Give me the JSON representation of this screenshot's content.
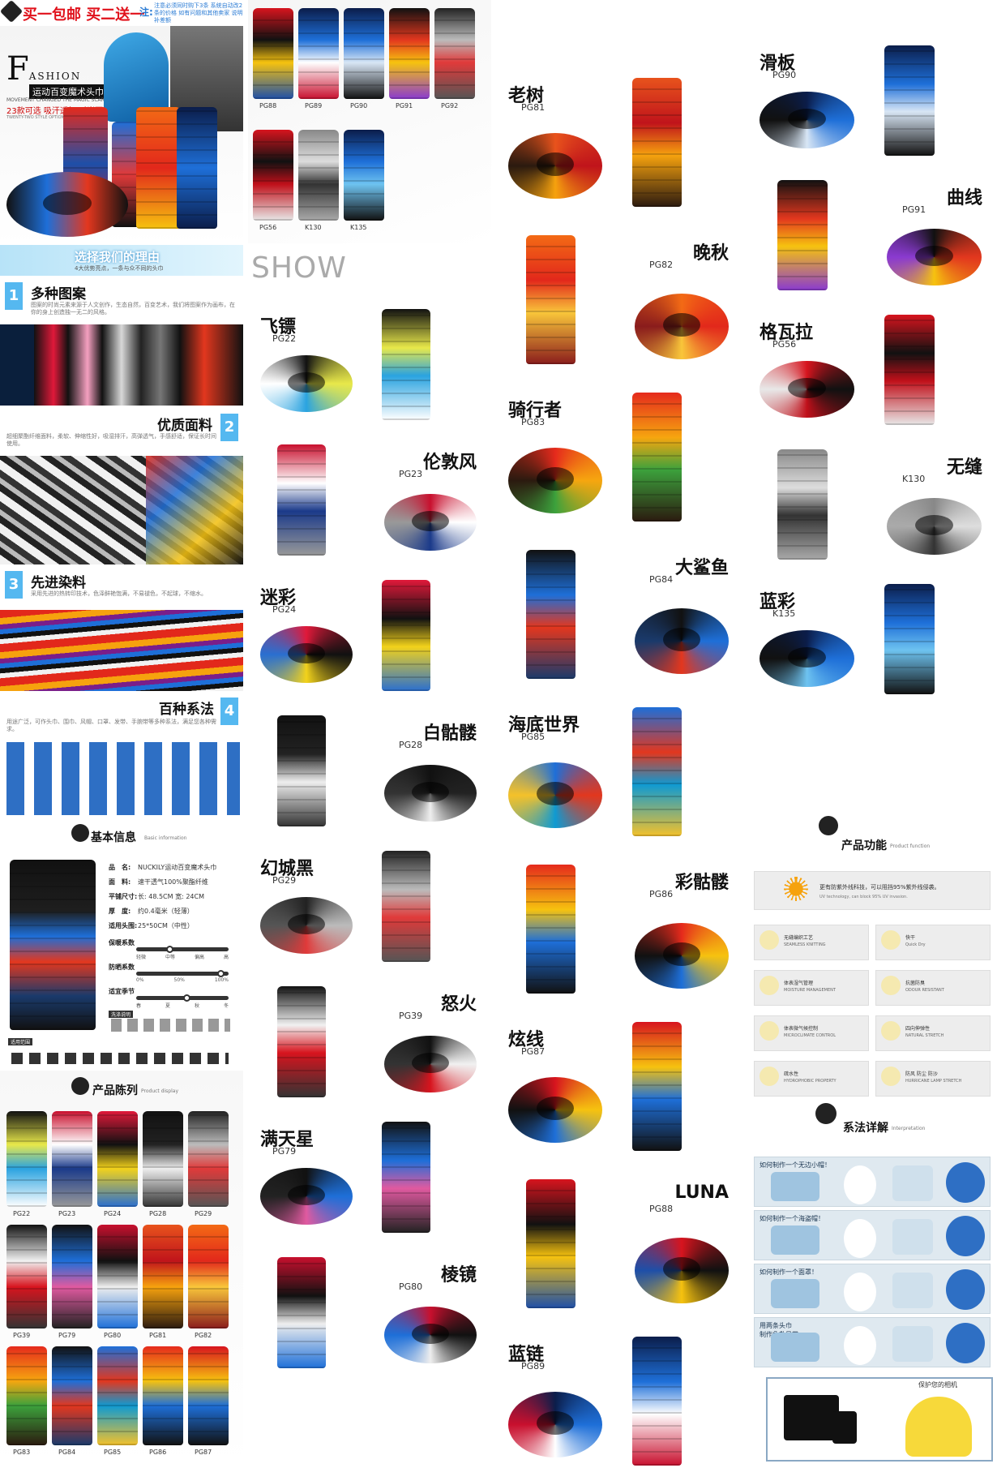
{
  "header": {
    "promo": "买一包邮 买二送一",
    "promo_colon": "注:",
    "promo_note": "注意必须同时购下3条 系统自动改2条的价格 如有问题和其他卖家 说明补差额"
  },
  "hero": {
    "fashion_initial": "F",
    "fashion_rest": "ASHION",
    "subtitle": "运动百变魔术头巾",
    "tagline_en": "MOVEMENT CHANGED THE MAGIC SCARF",
    "styles_line": "23款可选 吸汗透气 时尚百搭",
    "styles_en": "TWENTY-TWO STYLE OPTIONAL"
  },
  "reasons": {
    "title": "选择我们的理由",
    "sub": "4大优势亮点，一条与众不同的头巾"
  },
  "features": [
    {
      "num": "1",
      "title": "多种图案",
      "desc": "图案的时尚元素来源于人文创作，生态自然，百变艺术，我们将图案作为画布，在你的身上创造独一无二的风格。"
    },
    {
      "num": "2",
      "title": "优质面料",
      "desc": "超细聚酯纤维面料，柔软、伸缩性好，吸湿排汗，高弹透气，手感舒适，保证长时间使用。"
    },
    {
      "num": "3",
      "title": "先进染料",
      "desc": "采用先进的热转印技术，色泽鲜艳饱满，不易褪色，不起球，不缩水。"
    },
    {
      "num": "4",
      "title": "百种系法",
      "desc": "用途广泛，可作头巾、围巾、风帽、口罩、发带、手腕带等多种系法，满足您各种需求。"
    }
  ],
  "basic_info": {
    "title": "基本信息",
    "title_en": "Basic information",
    "rows": [
      {
        "k": "品　名:",
        "v": "NUCKILY运动百变魔术头巾"
      },
      {
        "k": "面　料:",
        "v": "速干透气100%聚酯纤维"
      },
      {
        "k": "平铺尺寸:",
        "v": "长: 48.5CM 宽: 24CM"
      },
      {
        "k": "厚　度:",
        "v": "约0.4毫米（轻薄）"
      },
      {
        "k": "适用头围:",
        "v": "25*50CM（中性）"
      }
    ],
    "scales": [
      {
        "label": "保暖系数",
        "marks": [
          "轻微",
          "中等",
          "偏高",
          "高"
        ],
        "level": 0.35
      },
      {
        "label": "防晒系数",
        "marks": [
          "0%",
          "50%",
          "100%"
        ],
        "level": 0.95
      },
      {
        "label": "适宜季节",
        "marks": [
          "春",
          "夏",
          "秋",
          "冬"
        ],
        "level": 0.55
      }
    ],
    "washing_label": "洗涤说明",
    "usage_label": "适用范围"
  },
  "display": {
    "title": "产品陈列",
    "title_en": "Product display",
    "row1": [
      "PG22",
      "PG23",
      "PG24",
      "PG28",
      "PG29"
    ],
    "row2": [
      "PG39",
      "PG79",
      "PG80",
      "PG81",
      "PG82"
    ],
    "row3": [
      "PG83",
      "PG84",
      "PG85",
      "PG86",
      "PG87"
    ]
  },
  "top_grid": {
    "row1": [
      "PG88",
      "PG89",
      "PG90",
      "PG91",
      "PG92"
    ],
    "row2": [
      "PG56",
      "K130",
      "K135"
    ]
  },
  "show_label": "SHOW",
  "products_col2": [
    {
      "name": "飞镖",
      "code": "PG22",
      "colors": [
        "#111",
        "#e8e84a",
        "#2aa3e0",
        "#ffffff"
      ]
    },
    {
      "name": "伦敦风",
      "code": "PG23",
      "colors": [
        "#c8102e",
        "#ffffff",
        "#1b3a8a",
        "#999"
      ]
    },
    {
      "name": "迷彩",
      "code": "PG24",
      "colors": [
        "#e0193a",
        "#111",
        "#f2d21b",
        "#2a6fd0"
      ]
    },
    {
      "name": "白骷髅",
      "code": "PG28",
      "colors": [
        "#111",
        "#222",
        "#eee",
        "#333"
      ]
    },
    {
      "name": "幻城黑",
      "code": "PG29",
      "colors": [
        "#222",
        "#bbb",
        "#e03a3a",
        "#555"
      ]
    },
    {
      "name": "怒火",
      "code": "PG39",
      "colors": [
        "#111",
        "#f1f1f1",
        "#d7141e",
        "#333"
      ]
    },
    {
      "name": "满天星",
      "code": "PG79",
      "colors": [
        "#111",
        "#1e6fd8",
        "#e05aa0",
        "#222"
      ]
    },
    {
      "name": "棱镜",
      "code": "PG80",
      "colors": [
        "#c8102e",
        "#111",
        "#eee",
        "#1e6fd8"
      ]
    }
  ],
  "products_col3": [
    {
      "name": "老树",
      "code": "PG81",
      "colors": [
        "#e8531c",
        "#c0141b",
        "#f6a20e",
        "#2b1a0f"
      ]
    },
    {
      "name": "晚秋",
      "code": "PG82",
      "colors": [
        "#f36a15",
        "#e2281b",
        "#f9c63a",
        "#8a1c1c"
      ]
    },
    {
      "name": "骑行者",
      "code": "PG83",
      "colors": [
        "#e52a1c",
        "#f6a60f",
        "#3ca13c",
        "#2b1a0f"
      ]
    },
    {
      "name": "大鲨鱼",
      "code": "PG84",
      "colors": [
        "#111",
        "#1e6fd8",
        "#e3371e",
        "#1a3a6b"
      ]
    },
    {
      "name": "海底世界",
      "code": "PG85",
      "colors": [
        "#1e6fd8",
        "#e2371e",
        "#0f9ad2",
        "#f4c12a"
      ]
    },
    {
      "name": "彩骷髅",
      "code": "PG86",
      "colors": [
        "#e52a1c",
        "#f6c20f",
        "#1e6fd8",
        "#111"
      ]
    },
    {
      "name": "炫线",
      "code": "PG87",
      "colors": [
        "#d7141e",
        "#f6c20f",
        "#1e6fd8",
        "#111"
      ]
    },
    {
      "name": "LUNA",
      "code": "PG88",
      "colors": [
        "#d7141e",
        "#111",
        "#f6c20f",
        "#1e4fa8"
      ]
    },
    {
      "name": "蓝链",
      "code": "PG89",
      "colors": [
        "#0b1d4a",
        "#1e6fd8",
        "#ffffff",
        "#c8102e"
      ]
    }
  ],
  "products_col4": [
    {
      "name": "滑板",
      "code": "PG90",
      "colors": [
        "#0b1d4a",
        "#1e6fd8",
        "#d8e6f5",
        "#111"
      ]
    },
    {
      "name": "曲线",
      "code": "PG91",
      "colors": [
        "#111",
        "#e2371e",
        "#f6c20f",
        "#8a3ad0"
      ]
    },
    {
      "name": "格瓦拉",
      "code": "PG56",
      "colors": [
        "#d7141e",
        "#111",
        "#c0101a",
        "#e8e8e8"
      ]
    },
    {
      "name": "无缝",
      "code": "K130",
      "colors": [
        "#888",
        "#ddd",
        "#333",
        "#aaa"
      ]
    },
    {
      "name": "蓝彩",
      "code": "K135",
      "colors": [
        "#0b1d4a",
        "#1e6fd8",
        "#6ec3f0",
        "#111"
      ]
    }
  ],
  "function": {
    "title": "产品功能",
    "title_en": "Product function",
    "uv_text": "更有防紫外线科技，可以阻挡95%紫外线侵袭。",
    "uv_en": "UV technology, can block 95% UV invasion.",
    "cards": [
      {
        "t": "无缝编织工艺",
        "e": "SEAMLESS KNITTING"
      },
      {
        "t": "快干",
        "e": "Quick Dry"
      },
      {
        "t": "体表湿气管理",
        "e": "MOISTURE MANAGEMENT"
      },
      {
        "t": "抗菌防臭",
        "e": "ODOUR RESISTANT"
      },
      {
        "t": "体表微气候控制",
        "e": "MICROCLIMATE CONTROL"
      },
      {
        "t": "四向伸弹性",
        "e": "NATURAL STRETCH"
      },
      {
        "t": "疏水性",
        "e": "HYDROPHOBIC PROPERTY"
      },
      {
        "t": "防风 防尘 防沙",
        "e": "HURRICANE LAMP STRETCH"
      }
    ]
  },
  "howto": {
    "title": "系法详解",
    "title_en": "Interpretation",
    "rows": [
      "如何制作一个无边小帽！",
      "如何制作一个海盗帽！",
      "如何制作一个面罩！",
      "用两条头巾\n制作急救吊带"
    ]
  },
  "camera_note": "保护您的相机",
  "colors": {
    "accent_blue": "#55b8f0",
    "promo_red": "#e0101a"
  }
}
